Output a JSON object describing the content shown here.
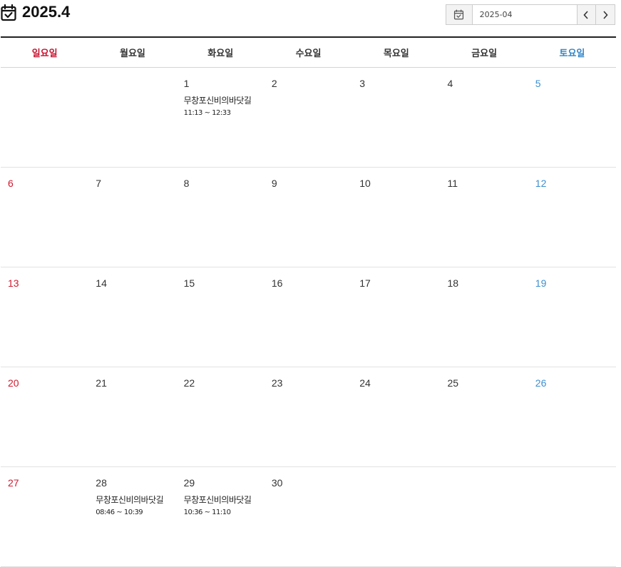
{
  "header": {
    "title": "2025.4",
    "icon": "calendar-check-icon",
    "date_value": "2025-04",
    "prev_icon": "chevron-left-icon",
    "next_icon": "chevron-right-icon"
  },
  "colors": {
    "sunday": "#d0182f",
    "saturday": "#3b8fd0",
    "rule": "#222222"
  },
  "weekdays": [
    "일요일",
    "월요일",
    "화요일",
    "수요일",
    "목요일",
    "금요일",
    "토요일"
  ],
  "weeks": [
    [
      {
        "day": ""
      },
      {
        "day": ""
      },
      {
        "day": "1",
        "events": [
          {
            "title": "무창포신비의바닷길",
            "time": "11:13 ~ 12:33"
          }
        ]
      },
      {
        "day": "2"
      },
      {
        "day": "3"
      },
      {
        "day": "4"
      },
      {
        "day": "5"
      }
    ],
    [
      {
        "day": "6"
      },
      {
        "day": "7"
      },
      {
        "day": "8"
      },
      {
        "day": "9"
      },
      {
        "day": "10"
      },
      {
        "day": "11"
      },
      {
        "day": "12"
      }
    ],
    [
      {
        "day": "13"
      },
      {
        "day": "14"
      },
      {
        "day": "15"
      },
      {
        "day": "16"
      },
      {
        "day": "17"
      },
      {
        "day": "18"
      },
      {
        "day": "19"
      }
    ],
    [
      {
        "day": "20"
      },
      {
        "day": "21"
      },
      {
        "day": "22"
      },
      {
        "day": "23"
      },
      {
        "day": "24"
      },
      {
        "day": "25"
      },
      {
        "day": "26"
      }
    ],
    [
      {
        "day": "27"
      },
      {
        "day": "28",
        "events": [
          {
            "title": "무창포신비의바닷길",
            "time": "08:46 ~ 10:39"
          }
        ]
      },
      {
        "day": "29",
        "events": [
          {
            "title": "무창포신비의바닷길",
            "time": "10:36 ~ 11:10"
          }
        ]
      },
      {
        "day": "30"
      },
      {
        "day": ""
      },
      {
        "day": ""
      },
      {
        "day": ""
      }
    ]
  ]
}
